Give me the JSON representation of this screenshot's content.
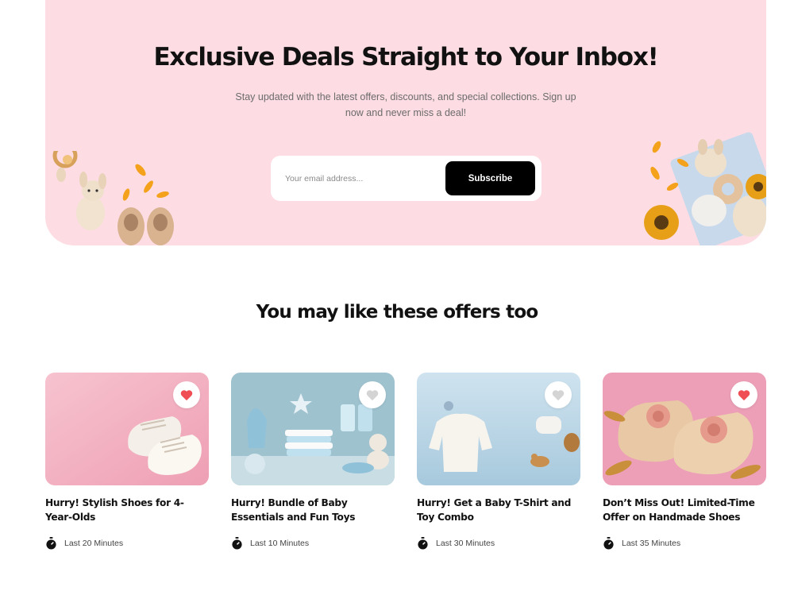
{
  "newsletter": {
    "title": "Exclusive Deals Straight to Your Inbox!",
    "description": "Stay updated with the latest offers, discounts, and special collections. Sign up now and never miss a deal!",
    "email_placeholder": "Your email address...",
    "subscribe_label": "Subscribe",
    "background_color": "#fddde3"
  },
  "offers": {
    "title": "You may like these offers too",
    "cards": [
      {
        "title": "Hurry! Stylish Shoes for 4-Year-Olds",
        "time": "Last 20 Minutes",
        "favorited": true,
        "image": "white-baby-shoes"
      },
      {
        "title": "Hurry! Bundle of Baby Essentials and Fun Toys",
        "time": "Last 10 Minutes",
        "favorited": false,
        "image": "blue-baby-essentials"
      },
      {
        "title": "Hurry! Get a Baby T-Shirt and Toy Combo",
        "time": "Last 30 Minutes",
        "favorited": false,
        "image": "baby-sweater-toys"
      },
      {
        "title": "Don’t Miss Out! Limited-Time Offer on Handmade Shoes",
        "time": "Last 35 Minutes",
        "favorited": true,
        "image": "crochet-shoes"
      }
    ]
  },
  "colors": {
    "heart_active": "#f04e55",
    "heart_inactive": "#d4d4d4",
    "button": "#000000"
  }
}
